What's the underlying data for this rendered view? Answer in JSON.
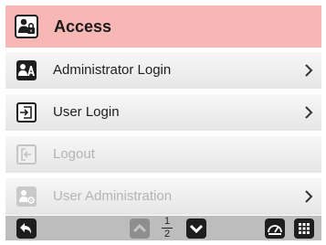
{
  "header": {
    "title": "Access",
    "icon": "user-lock-icon"
  },
  "menu": {
    "items": [
      {
        "label": "Administrator Login",
        "icon": "admin-user-icon",
        "enabled": true,
        "has_chevron": true
      },
      {
        "label": "User Login",
        "icon": "login-icon",
        "enabled": true,
        "has_chevron": true
      },
      {
        "label": "Logout",
        "icon": "logout-icon",
        "enabled": false,
        "has_chevron": false
      },
      {
        "label": "User Administration",
        "icon": "user-settings-icon",
        "enabled": false,
        "has_chevron": true
      }
    ]
  },
  "footer": {
    "page_current": "1",
    "page_total": "2",
    "back_icon": "back-arrow-icon",
    "page_up_icon": "chevron-up-icon",
    "page_down_icon": "chevron-down-icon",
    "dashboard_icon": "gauge-icon",
    "menu_icon": "grid-menu-icon"
  },
  "colors": {
    "header_bg": "#f6b7b5",
    "footer_bg": "#bdbdbd",
    "icon_dark": "#1e1e1e",
    "disabled": "#b4b4b4"
  }
}
